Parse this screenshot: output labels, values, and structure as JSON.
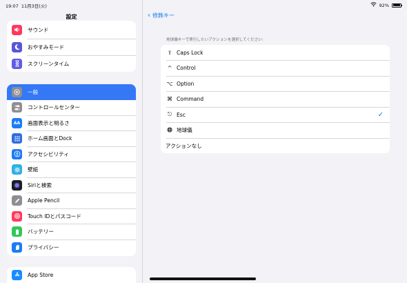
{
  "status": {
    "time": "19:07",
    "date": "11月3日(火)",
    "battery": "92%",
    "battery_level": 0.92
  },
  "sidebar": {
    "title": "設定",
    "group1": [
      {
        "label": "サウンド",
        "icon": "speaker-icon"
      },
      {
        "label": "おやすみモード",
        "icon": "moon-icon"
      },
      {
        "label": "スクリーンタイム",
        "icon": "hourglass-icon"
      }
    ],
    "group2": [
      {
        "label": "一般",
        "icon": "gear-icon",
        "selected": true
      },
      {
        "label": "コントロールセンター",
        "icon": "toggles-icon"
      },
      {
        "label": "画面表示と明るさ",
        "icon": "text-size-icon"
      },
      {
        "label": "ホーム画面とDock",
        "icon": "grid-icon"
      },
      {
        "label": "アクセシビリティ",
        "icon": "accessibility-icon"
      },
      {
        "label": "壁紙",
        "icon": "wallpaper-icon"
      },
      {
        "label": "Siriと検索",
        "icon": "siri-icon"
      },
      {
        "label": "Apple Pencil",
        "icon": "pencil-icon"
      },
      {
        "label": "Touch IDとパスコード",
        "icon": "fingerprint-icon"
      },
      {
        "label": "バッテリー",
        "icon": "battery-icon"
      },
      {
        "label": "プライバシー",
        "icon": "hand-icon"
      }
    ],
    "group3": [
      {
        "label": "App Store",
        "icon": "app-store-icon"
      }
    ],
    "icon_text": {
      "text_size": "AA"
    }
  },
  "main": {
    "back_label": "修飾キー",
    "section_header": "地球儀キーで実行したいアクションを選択してください:",
    "options": [
      {
        "label": "Caps Lock",
        "icon": "caps-lock-icon",
        "glyph": "⇪"
      },
      {
        "label": "Control",
        "icon": "control-icon",
        "glyph": "^"
      },
      {
        "label": "Option",
        "icon": "option-icon",
        "glyph": "⌥"
      },
      {
        "label": "Command",
        "icon": "command-icon",
        "glyph": "⌘"
      },
      {
        "label": "Esc",
        "icon": "escape-icon",
        "glyph": "⎋",
        "checked": true
      },
      {
        "label": "地球儀",
        "icon": "globe-icon",
        "glyph": "🌐"
      }
    ],
    "no_action": "アクションなし"
  },
  "colors": {
    "accent": "#1a7cf5",
    "selected": "#3478f6"
  }
}
